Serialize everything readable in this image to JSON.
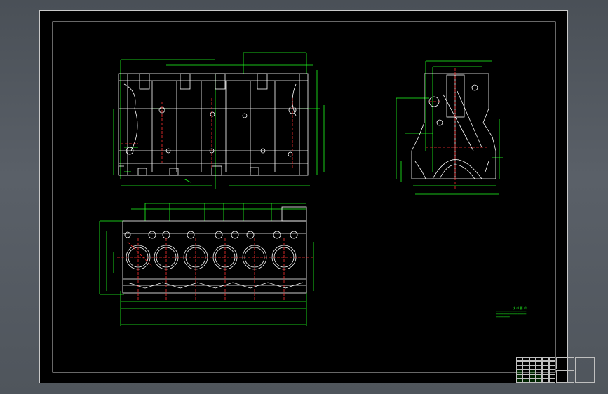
{
  "app": {
    "window_title": ""
  },
  "colors": {
    "background_outer": "#4f555c",
    "canvas": "#000000",
    "geometry": "#ffffff",
    "dimension": "#20ff20",
    "centerline": "#ff3030",
    "frame": "#c9c9c9"
  },
  "views": {
    "front_view": {
      "name": "front-elevation"
    },
    "side_view": {
      "name": "side-section"
    },
    "top_view": {
      "name": "top-view",
      "cylinder_count": 6
    }
  },
  "technical_notes": {
    "title": "技  术  要  求",
    "lines": [
      "",
      "",
      ""
    ]
  },
  "title_block": {
    "part_name": "",
    "drawing_title": ""
  }
}
